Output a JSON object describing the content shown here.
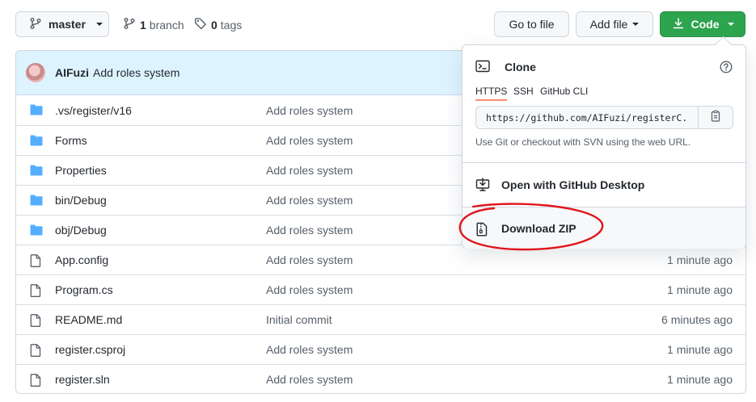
{
  "toolbar": {
    "branch_label": "master",
    "branch_count": "1",
    "branch_word": "branch",
    "tag_count": "0",
    "tag_word": "tags",
    "go_to_file": "Go to file",
    "add_file": "Add file",
    "code": "Code"
  },
  "commit": {
    "author": "AIFuzi",
    "message": "Add roles system"
  },
  "files": [
    {
      "type": "folder",
      "name": ".vs/register/v16",
      "message": "Add roles system",
      "time": ""
    },
    {
      "type": "folder",
      "name": "Forms",
      "message": "Add roles system",
      "time": ""
    },
    {
      "type": "folder",
      "name": "Properties",
      "message": "Add roles system",
      "time": ""
    },
    {
      "type": "folder",
      "name": "bin/Debug",
      "message": "Add roles system",
      "time": ""
    },
    {
      "type": "folder",
      "name": "obj/Debug",
      "message": "Add roles system",
      "time": ""
    },
    {
      "type": "file",
      "name": "App.config",
      "message": "Add roles system",
      "time": "1 minute ago"
    },
    {
      "type": "file",
      "name": "Program.cs",
      "message": "Add roles system",
      "time": "1 minute ago"
    },
    {
      "type": "file",
      "name": "README.md",
      "message": "Initial commit",
      "time": "6 minutes ago"
    },
    {
      "type": "file",
      "name": "register.csproj",
      "message": "Add roles system",
      "time": "1 minute ago"
    },
    {
      "type": "file",
      "name": "register.sln",
      "message": "Add roles system",
      "time": "1 minute ago"
    }
  ],
  "code_menu": {
    "clone_title": "Clone",
    "tabs": [
      "HTTPS",
      "SSH",
      "GitHub CLI"
    ],
    "clone_url": "https://github.com/AIFuzi/registerC.gi",
    "hint": "Use Git or checkout with SVN using the web URL.",
    "open_desktop": "Open with GitHub Desktop",
    "download_zip": "Download ZIP"
  },
  "colors": {
    "code_button": "#2da44e",
    "commit_header": "#ddf4ff",
    "folder_icon": "#54aeff",
    "annotation": "#e0151b"
  }
}
